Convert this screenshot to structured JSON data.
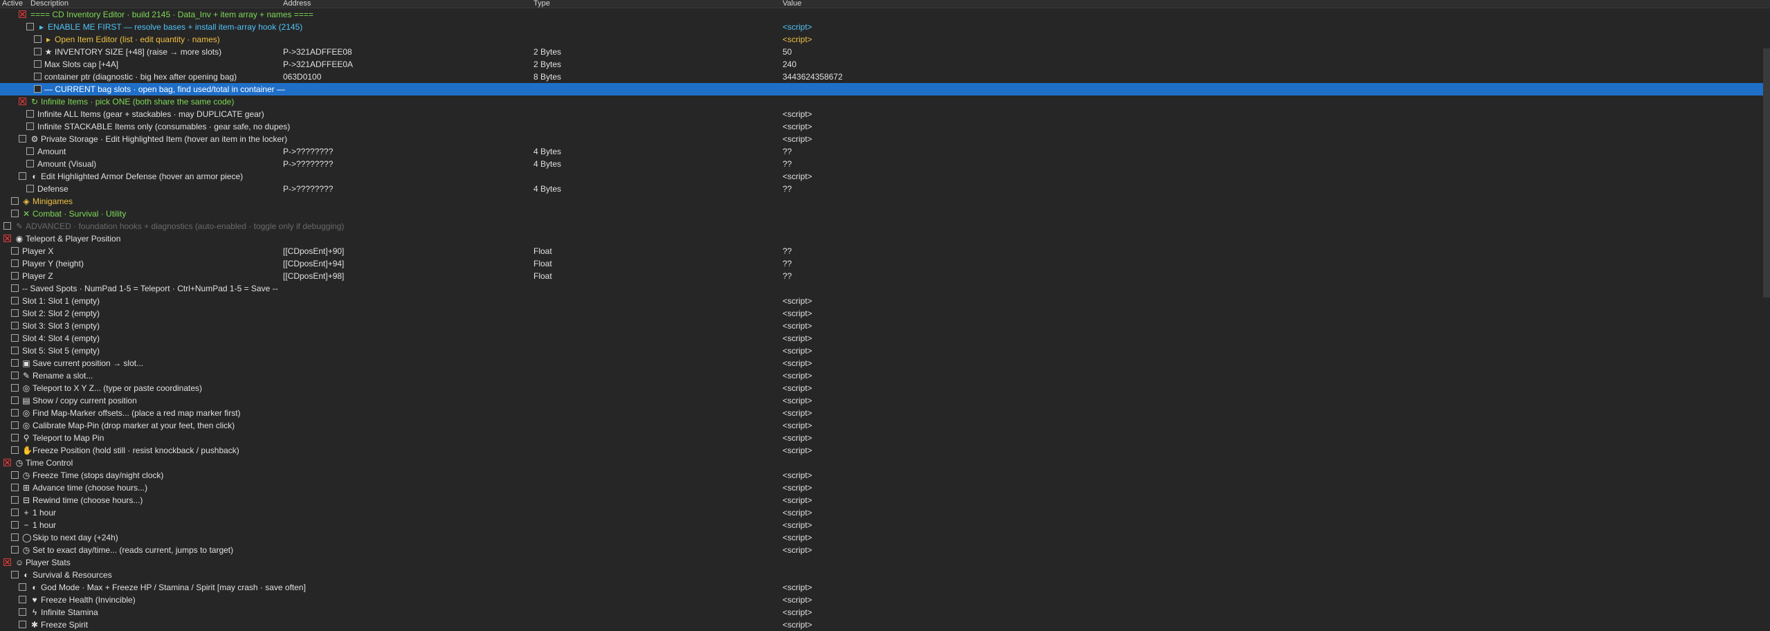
{
  "header": {
    "active": "Active",
    "description": "Description",
    "address": "Address",
    "type": "Type",
    "value": "Value"
  },
  "colors": {
    "background": "#262626",
    "selected": "#1f6fc9",
    "green": "#7ed957",
    "cyan": "#4fc3f7",
    "yellow": "#f0c040",
    "grey": "#6a6a6a"
  },
  "rows": [
    {
      "cb": {
        "x": 27,
        "checked": true
      },
      "x": 44,
      "icon": "",
      "desc": "==== CD Inventory Editor  ·  build 2145  ·  Data_Inv + item array + names ====",
      "color": "#7ed957",
      "addr": "",
      "type": "",
      "value": ""
    },
    {
      "cb": {
        "x": 38,
        "checked": false
      },
      "x": 54,
      "icon": "▸",
      "desc": "ENABLE ME FIRST  —  resolve bases + install item-array hook (2145)",
      "color": "#4fc3f7",
      "addr": "",
      "type": "",
      "value": "<script>",
      "vcolor": "#4fc3f7"
    },
    {
      "cb": {
        "x": 49,
        "checked": false
      },
      "x": 64,
      "icon": "▸",
      "desc": "Open Item Editor  (list · edit quantity · names)",
      "color": "#f0c040",
      "addr": "",
      "type": "",
      "value": "<script>",
      "vcolor": "#f0c040"
    },
    {
      "cb": {
        "x": 49,
        "checked": false
      },
      "x": 64,
      "icon": "★",
      "desc": "INVENTORY SIZE  [+48]   (raise → more slots)",
      "color": "#e0e0e0",
      "addr": "P->321ADFFEE08",
      "type": "2 Bytes",
      "value": "50"
    },
    {
      "cb": {
        "x": 49,
        "checked": false
      },
      "x": 64,
      "icon": "",
      "desc": "Max Slots cap  [+4A]",
      "color": "#e0e0e0",
      "addr": "P->321ADFFEE0A",
      "type": "2 Bytes",
      "value": "240"
    },
    {
      "cb": {
        "x": 49,
        "checked": false
      },
      "x": 64,
      "icon": "",
      "desc": "container ptr  (diagnostic · big hex after opening bag)",
      "color": "#e0e0e0",
      "addr": "063D0100",
      "type": "8 Bytes",
      "value": "3443624358672"
    },
    {
      "cb": {
        "x": 49,
        "checked": false
      },
      "x": 64,
      "icon": "",
      "desc": "— CURRENT bag slots · open bag, find used/total in container —",
      "color": "#ffffff",
      "addr": "",
      "type": "",
      "value": "",
      "selected": true
    },
    {
      "cb": {
        "x": 27,
        "checked": true
      },
      "x": 44,
      "icon": "↻",
      "desc": "Infinite Items   ·   pick ONE (both share the same code)",
      "color": "#7ed957",
      "addr": "",
      "type": "",
      "value": ""
    },
    {
      "cb": {
        "x": 38,
        "checked": false
      },
      "x": 54,
      "icon": "",
      "desc": "Infinite ALL Items   (gear + stackables · may DUPLICATE gear)",
      "color": "#e0e0e0",
      "addr": "",
      "type": "",
      "value": "<script>"
    },
    {
      "cb": {
        "x": 38,
        "checked": false
      },
      "x": 54,
      "icon": "",
      "desc": "Infinite STACKABLE Items only   (consumables · gear safe, no dupes)",
      "color": "#e0e0e0",
      "addr": "",
      "type": "",
      "value": "<script>"
    },
    {
      "cb": {
        "x": 27,
        "checked": false
      },
      "x": 44,
      "icon": "⚙",
      "desc": "Private Storage · Edit Highlighted Item   (hover an item in the locker)",
      "color": "#e0e0e0",
      "addr": "",
      "type": "",
      "value": "<script>"
    },
    {
      "cb": {
        "x": 38,
        "checked": false
      },
      "x": 54,
      "icon": "",
      "desc": "Amount",
      "color": "#e0e0e0",
      "addr": "P->????????",
      "type": "4 Bytes",
      "value": "??"
    },
    {
      "cb": {
        "x": 38,
        "checked": false
      },
      "x": 54,
      "icon": "",
      "desc": "Amount (Visual)",
      "color": "#e0e0e0",
      "addr": "P->????????",
      "type": "4 Bytes",
      "value": "??"
    },
    {
      "cb": {
        "x": 27,
        "checked": false
      },
      "x": 44,
      "icon": "◐",
      "desc": "Edit Highlighted Armor Defense   (hover an armor piece)",
      "color": "#e0e0e0",
      "addr": "",
      "type": "",
      "value": "<script>"
    },
    {
      "cb": {
        "x": 38,
        "checked": false
      },
      "x": 54,
      "icon": "",
      "desc": "Defense",
      "color": "#e0e0e0",
      "addr": "P->????????",
      "type": "4 Bytes",
      "value": "??"
    },
    {
      "cb": {
        "x": 16,
        "checked": false
      },
      "x": 32,
      "icon": "◈",
      "desc": "Minigames",
      "color": "#f0c040",
      "addr": "",
      "type": "",
      "value": ""
    },
    {
      "cb": {
        "x": 16,
        "checked": false
      },
      "x": 32,
      "icon": "✕",
      "desc": "Combat · Survival · Utility",
      "color": "#7ed957",
      "addr": "",
      "type": "",
      "value": ""
    },
    {
      "cb": {
        "x": 5,
        "checked": false
      },
      "x": 22,
      "icon": "✎",
      "desc": "ADVANCED  ·  foundation hooks + diagnostics  (auto-enabled · toggle only if debugging)",
      "color": "#6a6a6a",
      "addr": "",
      "type": "",
      "value": ""
    },
    {
      "cb": {
        "x": 5,
        "checked": true
      },
      "x": 22,
      "icon": "◉",
      "desc": "Teleport & Player Position",
      "color": "#e0e0e0",
      "addr": "",
      "type": "",
      "value": ""
    },
    {
      "cb": {
        "x": 16,
        "checked": false
      },
      "x": 32,
      "icon": "",
      "desc": "Player  X",
      "color": "#e0e0e0",
      "addr": "[[CDposEnt]+90]",
      "type": "Float",
      "value": "??"
    },
    {
      "cb": {
        "x": 16,
        "checked": false
      },
      "x": 32,
      "icon": "",
      "desc": "Player  Y (height)",
      "color": "#e0e0e0",
      "addr": "[[CDposEnt]+94]",
      "type": "Float",
      "value": "??"
    },
    {
      "cb": {
        "x": 16,
        "checked": false
      },
      "x": 32,
      "icon": "",
      "desc": "Player  Z",
      "color": "#e0e0e0",
      "addr": "[[CDposEnt]+98]",
      "type": "Float",
      "value": "??"
    },
    {
      "cb": {
        "x": 16,
        "checked": false
      },
      "x": 32,
      "icon": "",
      "desc": "-- Saved Spots  ·  NumPad 1-5 = Teleport  ·  Ctrl+NumPad 1-5 = Save --",
      "color": "#e0e0e0",
      "addr": "",
      "type": "",
      "value": ""
    },
    {
      "cb": {
        "x": 16,
        "checked": false
      },
      "x": 32,
      "icon": "",
      "desc": "Slot 1:  Slot 1   (empty)",
      "color": "#e0e0e0",
      "addr": "",
      "type": "",
      "value": "<script>"
    },
    {
      "cb": {
        "x": 16,
        "checked": false
      },
      "x": 32,
      "icon": "",
      "desc": "Slot 2:  Slot 2   (empty)",
      "color": "#e0e0e0",
      "addr": "",
      "type": "",
      "value": "<script>"
    },
    {
      "cb": {
        "x": 16,
        "checked": false
      },
      "x": 32,
      "icon": "",
      "desc": "Slot 3:  Slot 3   (empty)",
      "color": "#e0e0e0",
      "addr": "",
      "type": "",
      "value": "<script>"
    },
    {
      "cb": {
        "x": 16,
        "checked": false
      },
      "x": 32,
      "icon": "",
      "desc": "Slot 4:  Slot 4   (empty)",
      "color": "#e0e0e0",
      "addr": "",
      "type": "",
      "value": "<script>"
    },
    {
      "cb": {
        "x": 16,
        "checked": false
      },
      "x": 32,
      "icon": "",
      "desc": "Slot 5:  Slot 5   (empty)",
      "color": "#e0e0e0",
      "addr": "",
      "type": "",
      "value": "<script>"
    },
    {
      "cb": {
        "x": 16,
        "checked": false
      },
      "x": 32,
      "icon": "▣",
      "desc": "Save current position → slot...",
      "color": "#e0e0e0",
      "addr": "",
      "type": "",
      "value": "<script>"
    },
    {
      "cb": {
        "x": 16,
        "checked": false
      },
      "x": 32,
      "icon": "✎",
      "desc": "Rename a slot...",
      "color": "#e0e0e0",
      "addr": "",
      "type": "",
      "value": "<script>"
    },
    {
      "cb": {
        "x": 16,
        "checked": false
      },
      "x": 32,
      "icon": "◎",
      "desc": "Teleport to X Y Z...  (type or paste coordinates)",
      "color": "#e0e0e0",
      "addr": "",
      "type": "",
      "value": "<script>"
    },
    {
      "cb": {
        "x": 16,
        "checked": false
      },
      "x": 32,
      "icon": "▤",
      "desc": "Show / copy current position",
      "color": "#e0e0e0",
      "addr": "",
      "type": "",
      "value": "<script>"
    },
    {
      "cb": {
        "x": 16,
        "checked": false
      },
      "x": 32,
      "icon": "◎",
      "desc": "Find Map-Marker offsets...  (place a red map marker first)",
      "color": "#e0e0e0",
      "addr": "",
      "type": "",
      "value": "<script>"
    },
    {
      "cb": {
        "x": 16,
        "checked": false
      },
      "x": 32,
      "icon": "◎",
      "desc": "Calibrate Map-Pin  (drop marker at your feet, then click)",
      "color": "#e0e0e0",
      "addr": "",
      "type": "",
      "value": "<script>"
    },
    {
      "cb": {
        "x": 16,
        "checked": false
      },
      "x": 32,
      "icon": "⚲",
      "desc": "Teleport to Map Pin",
      "color": "#e0e0e0",
      "addr": "",
      "type": "",
      "value": "<script>"
    },
    {
      "cb": {
        "x": 16,
        "checked": false
      },
      "x": 32,
      "icon": "✋",
      "desc": "Freeze Position  (hold still · resist knockback / pushback)",
      "color": "#e0e0e0",
      "addr": "",
      "type": "",
      "value": "<script>"
    },
    {
      "cb": {
        "x": 5,
        "checked": true
      },
      "x": 22,
      "icon": "◷",
      "desc": "Time Control",
      "color": "#e0e0e0",
      "addr": "",
      "type": "",
      "value": ""
    },
    {
      "cb": {
        "x": 16,
        "checked": false
      },
      "x": 32,
      "icon": "◷",
      "desc": "Freeze Time (stops day/night clock)",
      "color": "#e0e0e0",
      "addr": "",
      "type": "",
      "value": "<script>"
    },
    {
      "cb": {
        "x": 16,
        "checked": false
      },
      "x": 32,
      "icon": "⊞",
      "desc": "Advance time  (choose hours...)",
      "color": "#e0e0e0",
      "addr": "",
      "type": "",
      "value": "<script>"
    },
    {
      "cb": {
        "x": 16,
        "checked": false
      },
      "x": 32,
      "icon": "⊟",
      "desc": "Rewind time  (choose hours...)",
      "color": "#e0e0e0",
      "addr": "",
      "type": "",
      "value": "<script>"
    },
    {
      "cb": {
        "x": 16,
        "checked": false
      },
      "x": 32,
      "icon": "+",
      "desc": "1 hour",
      "color": "#e0e0e0",
      "addr": "",
      "type": "",
      "value": "<script>"
    },
    {
      "cb": {
        "x": 16,
        "checked": false
      },
      "x": 32,
      "icon": "−",
      "desc": "1 hour",
      "color": "#e0e0e0",
      "addr": "",
      "type": "",
      "value": "<script>"
    },
    {
      "cb": {
        "x": 16,
        "checked": false
      },
      "x": 32,
      "icon": "◯",
      "desc": "Skip to next day  (+24h)",
      "color": "#e0e0e0",
      "addr": "",
      "type": "",
      "value": "<script>"
    },
    {
      "cb": {
        "x": 16,
        "checked": false
      },
      "x": 32,
      "icon": "◷",
      "desc": "Set to exact day/time...  (reads current, jumps to target)",
      "color": "#e0e0e0",
      "addr": "",
      "type": "",
      "value": "<script>"
    },
    {
      "cb": {
        "x": 5,
        "checked": true
      },
      "x": 22,
      "icon": "☺",
      "desc": "Player Stats",
      "color": "#e0e0e0",
      "addr": "",
      "type": "",
      "value": ""
    },
    {
      "cb": {
        "x": 16,
        "checked": false
      },
      "x": 32,
      "icon": "◐",
      "desc": "Survival & Resources",
      "color": "#e0e0e0",
      "addr": "",
      "type": "",
      "value": ""
    },
    {
      "cb": {
        "x": 27,
        "checked": false
      },
      "x": 44,
      "icon": "◐",
      "desc": "God Mode  ·  Max + Freeze HP / Stamina / Spirit   [may crash · save often]",
      "color": "#e0e0e0",
      "addr": "",
      "type": "",
      "value": "<script>"
    },
    {
      "cb": {
        "x": 27,
        "checked": false
      },
      "x": 44,
      "icon": "♥",
      "desc": "Freeze Health  (Invincible)",
      "color": "#e0e0e0",
      "addr": "",
      "type": "",
      "value": "<script>"
    },
    {
      "cb": {
        "x": 27,
        "checked": false
      },
      "x": 44,
      "icon": "ϟ",
      "desc": "Infinite Stamina",
      "color": "#e0e0e0",
      "addr": "",
      "type": "",
      "value": "<script>"
    },
    {
      "cb": {
        "x": 27,
        "checked": false
      },
      "x": 44,
      "icon": "✱",
      "desc": "Freeze Spirit",
      "color": "#e0e0e0",
      "addr": "",
      "type": "",
      "value": "<script>"
    }
  ]
}
